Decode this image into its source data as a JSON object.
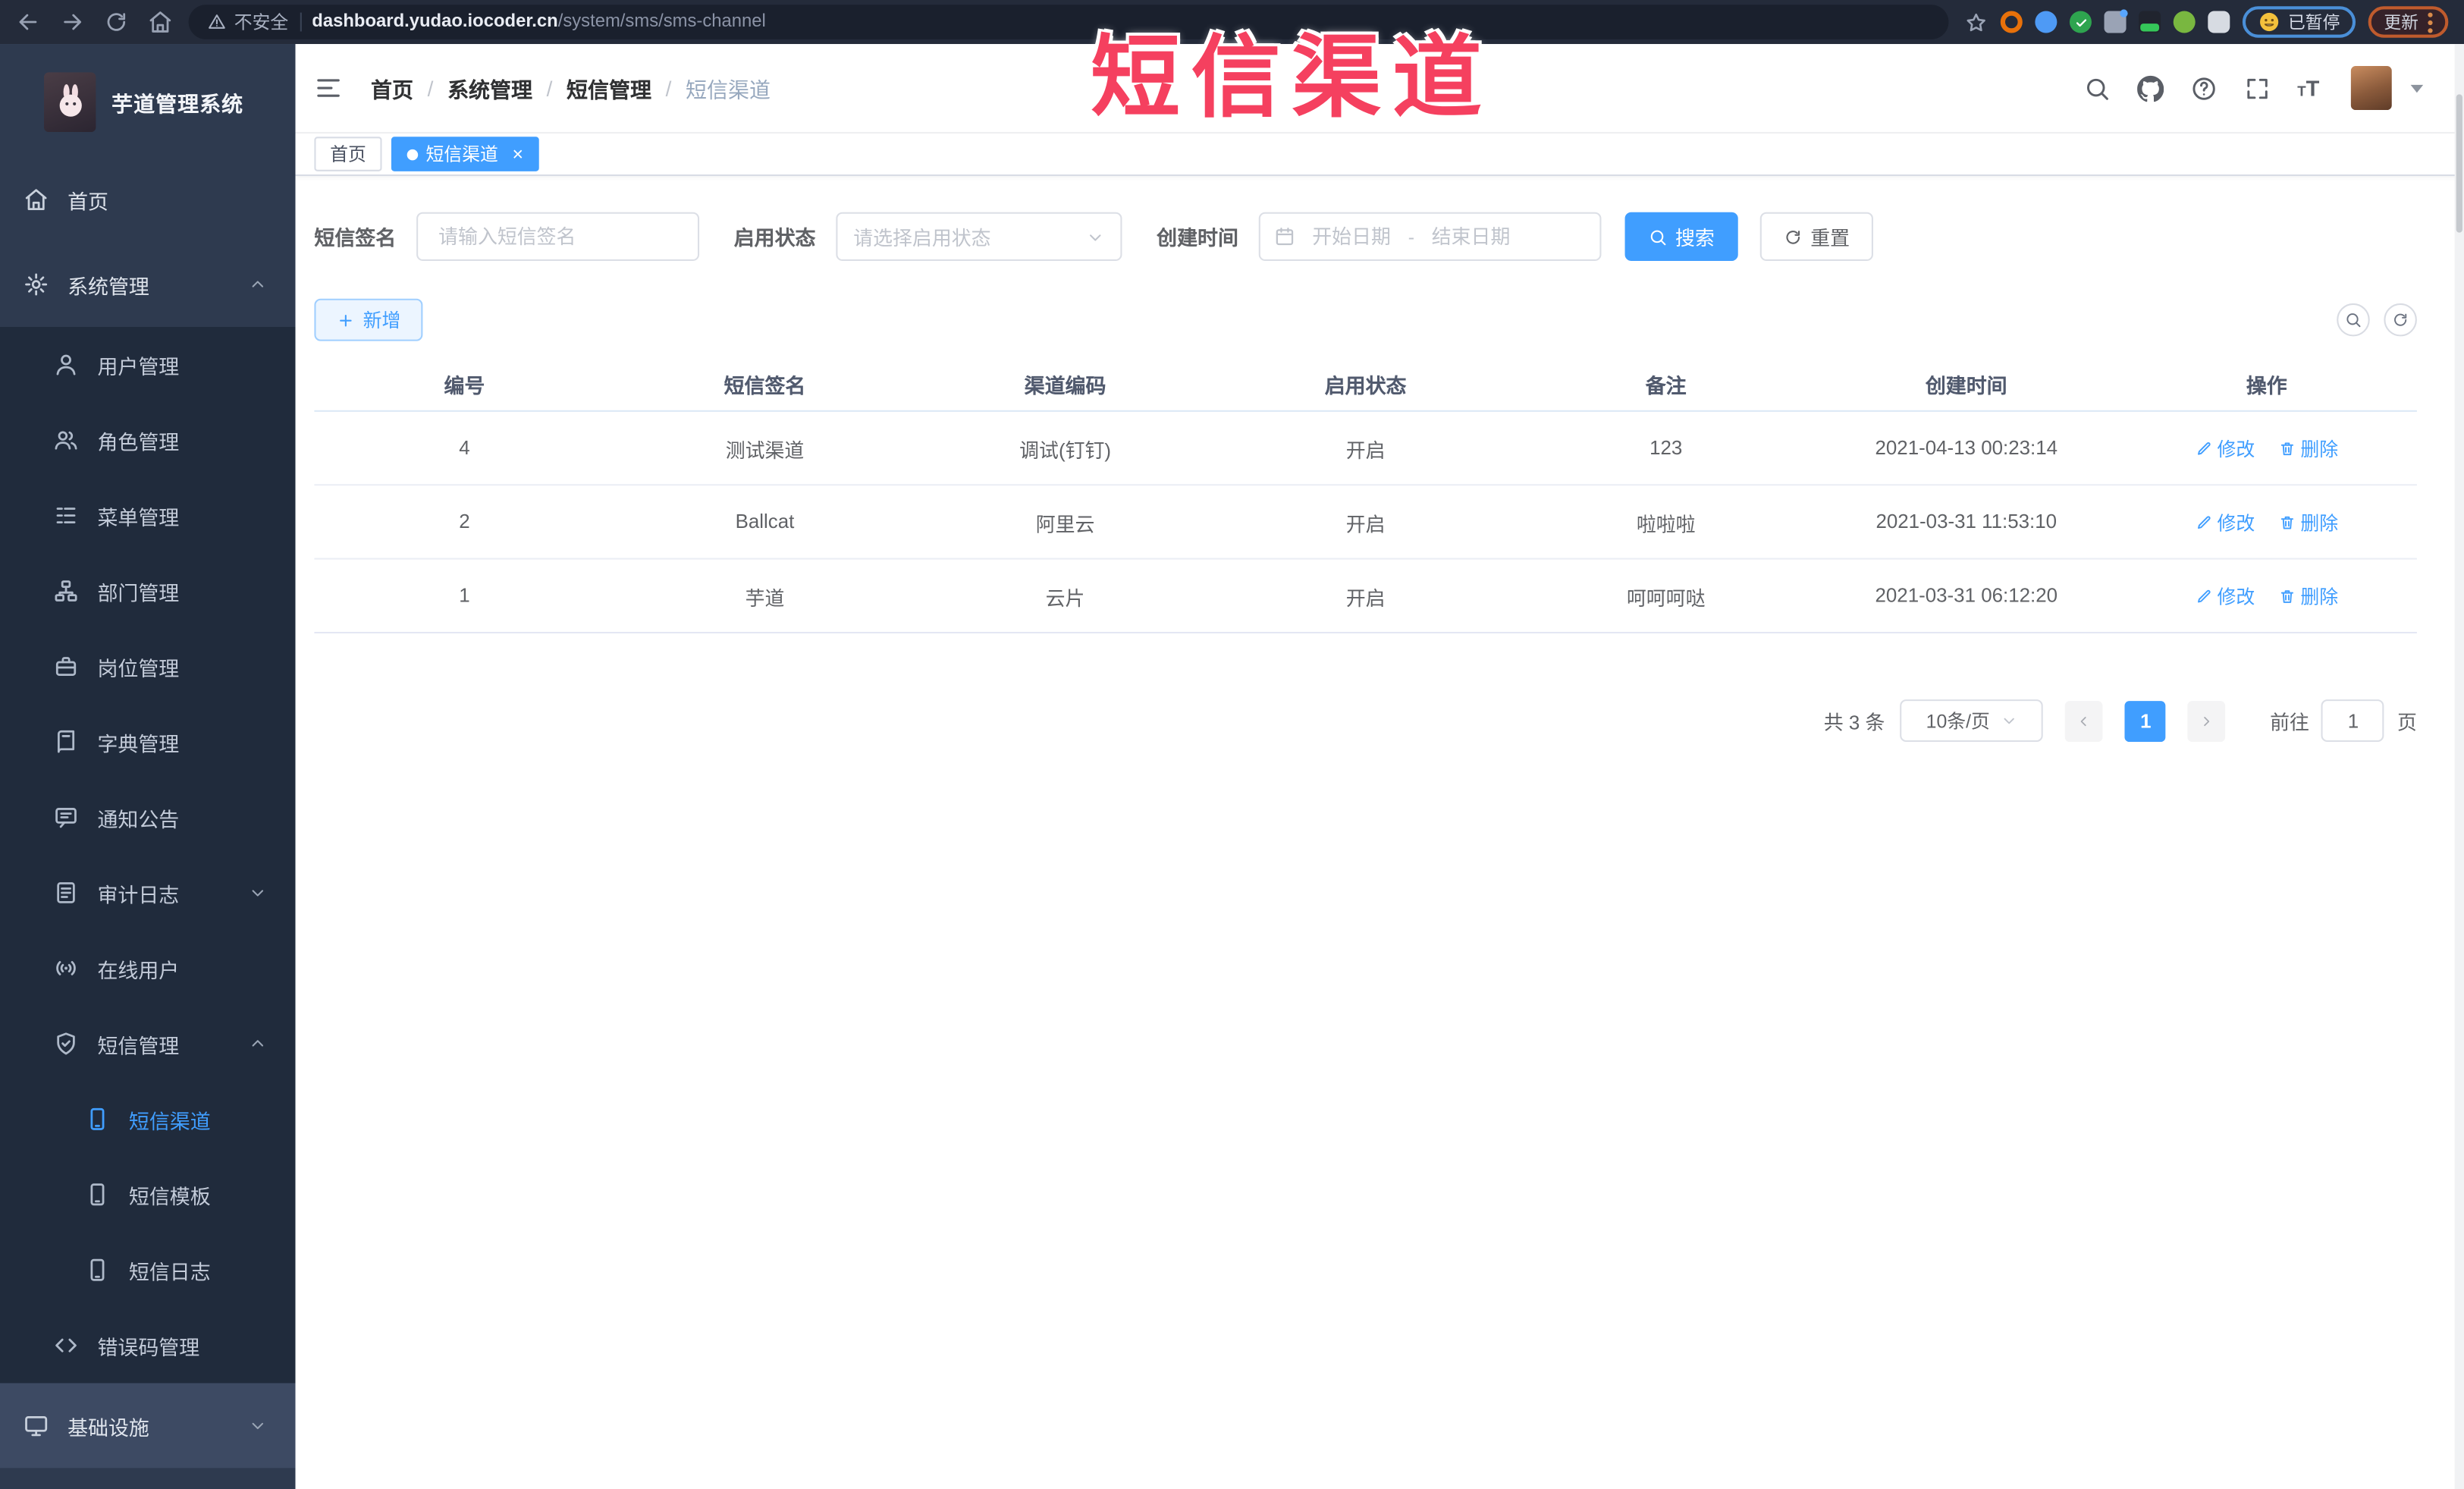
{
  "browser": {
    "security": "不安全",
    "url_domain": "dashboard.yudao.iocoder.cn",
    "url_path": "/system/sms/sms-channel",
    "paused_label": "已暂停",
    "update_label": "更新"
  },
  "watermark": "短信渠道",
  "app": {
    "title": "芋道管理系统"
  },
  "breadcrumb": {
    "items": [
      "首页",
      "系统管理",
      "短信管理",
      "短信渠道"
    ],
    "separator": "/"
  },
  "tabs": [
    {
      "label": "首页"
    },
    {
      "label": "短信渠道"
    }
  ],
  "sidebar": {
    "items": [
      {
        "label": "首页"
      },
      {
        "label": "系统管理"
      },
      {
        "label": "用户管理"
      },
      {
        "label": "角色管理"
      },
      {
        "label": "菜单管理"
      },
      {
        "label": "部门管理"
      },
      {
        "label": "岗位管理"
      },
      {
        "label": "字典管理"
      },
      {
        "label": "通知公告"
      },
      {
        "label": "审计日志"
      },
      {
        "label": "在线用户"
      },
      {
        "label": "短信管理"
      },
      {
        "label": "短信渠道"
      },
      {
        "label": "短信模板"
      },
      {
        "label": "短信日志"
      },
      {
        "label": "错误码管理"
      },
      {
        "label": "基础设施"
      }
    ]
  },
  "search": {
    "sign_label": "短信签名",
    "sign_placeholder": "请输入短信签名",
    "status_label": "启用状态",
    "status_placeholder": "请选择启用状态",
    "time_label": "创建时间",
    "start_placeholder": "开始日期",
    "range_separator": "-",
    "end_placeholder": "结束日期",
    "search_label": "搜索",
    "reset_label": "重置"
  },
  "toolbar": {
    "add_label": "新增"
  },
  "table": {
    "columns": [
      "编号",
      "短信签名",
      "渠道编码",
      "启用状态",
      "备注",
      "创建时间",
      "操作"
    ],
    "ops": {
      "edit": "修改",
      "delete": "删除"
    },
    "rows": [
      {
        "id": "4",
        "signature": "测试渠道",
        "code": "调试(钉钉)",
        "status": "开启",
        "remark": "123",
        "created": "2021-04-13 00:23:14"
      },
      {
        "id": "2",
        "signature": "Ballcat",
        "code": "阿里云",
        "status": "开启",
        "remark": "啦啦啦",
        "created": "2021-03-31 11:53:10"
      },
      {
        "id": "1",
        "signature": "芋道",
        "code": "云片",
        "status": "开启",
        "remark": "呵呵呵哒",
        "created": "2021-03-31 06:12:20"
      }
    ]
  },
  "pagination": {
    "total": "共 3 条",
    "page_size": "10条/页",
    "page": "1",
    "goto_label": "前往",
    "goto_value": "1",
    "unit_label": "页"
  },
  "colors": {
    "accent": "#409eff",
    "watermark_red": "#f5405f",
    "sidebar_bg": "#2e3a4f",
    "submenu_bg": "#202b3c",
    "browser_bar_bg": "#242b3a"
  }
}
